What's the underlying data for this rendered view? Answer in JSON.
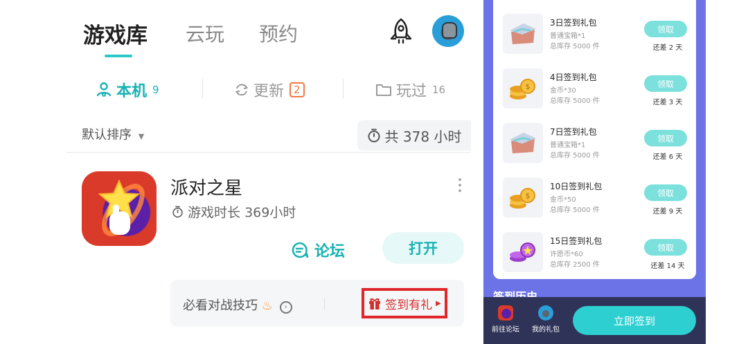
{
  "header": {
    "tabs": [
      {
        "label": "游戏库",
        "active": true
      },
      {
        "label": "云玩",
        "active": false
      },
      {
        "label": "预约",
        "active": false
      }
    ],
    "rocket_icon": "rocket-icon",
    "avatar_icon": "avatar"
  },
  "filters": {
    "local": {
      "label": "本机",
      "count": "9"
    },
    "update": {
      "label": "更新",
      "count": "2"
    },
    "played": {
      "label": "玩过",
      "count": "16"
    }
  },
  "sort": {
    "label": "默认排序"
  },
  "total_time": "共 378 小时",
  "game": {
    "title": "派对之星",
    "playtime": "游戏时长 369小时",
    "forum_label": "论坛",
    "open_label": "打开"
  },
  "tip": {
    "text": "必看对战技巧",
    "checkin_label": "签到有礼"
  },
  "rewards": [
    {
      "title": "3日签到礼包",
      "item": "普通宝箱*1",
      "stock": "总库存 5000 件",
      "claim": "领取",
      "remaining": "还差 2 天",
      "icon": "chest-icon"
    },
    {
      "title": "4日签到礼包",
      "item": "金币*30",
      "stock": "总库存 5000 件",
      "claim": "领取",
      "remaining": "还差 3 天",
      "icon": "coins-icon"
    },
    {
      "title": "7日签到礼包",
      "item": "普通宝箱*1",
      "stock": "总库存 5000 件",
      "claim": "领取",
      "remaining": "还差 6 天",
      "icon": "chest-icon"
    },
    {
      "title": "10日签到礼包",
      "item": "金币*50",
      "stock": "总库存 5000 件",
      "claim": "领取",
      "remaining": "还差 9 天",
      "icon": "coins-icon"
    },
    {
      "title": "15日签到礼包",
      "item": "许愿币*60",
      "stock": "总库存 2500 件",
      "claim": "领取",
      "remaining": "还差 14 天",
      "icon": "wish-coin-icon"
    }
  ],
  "history_label": "签到历史",
  "bottom_bar": {
    "forum_label": "前往论坛",
    "gifts_label": "我的礼包",
    "signin_label": "立即签到"
  },
  "colors": {
    "accent": "#18b2b2",
    "panel": "#6c73e7",
    "claim": "#7ce0dc",
    "highlight": "#e0252b"
  }
}
